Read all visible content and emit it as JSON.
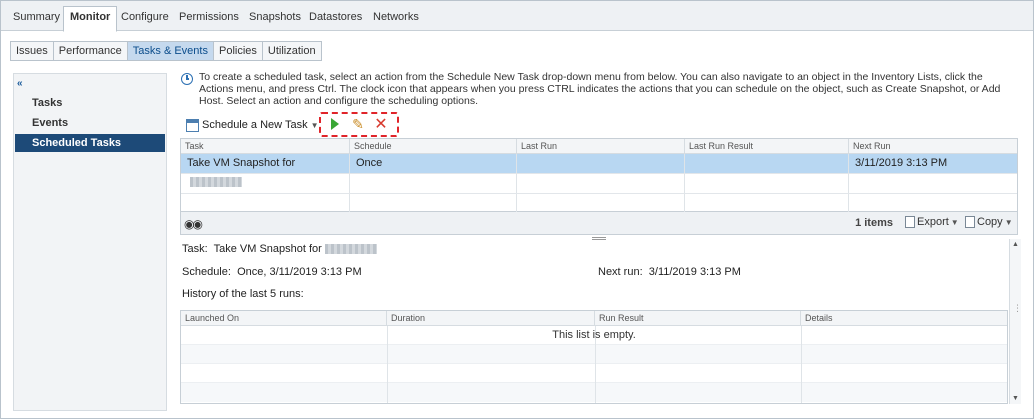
{
  "top_tabs": [
    {
      "label": "Summary"
    },
    {
      "label": "Monitor"
    },
    {
      "label": "Configure"
    },
    {
      "label": "Permissions"
    },
    {
      "label": "Snapshots"
    },
    {
      "label": "Datastores"
    },
    {
      "label": "Networks"
    }
  ],
  "sub_tabs": [
    {
      "label": "Issues"
    },
    {
      "label": "Performance"
    },
    {
      "label": "Tasks & Events"
    },
    {
      "label": "Policies"
    },
    {
      "label": "Utilization"
    }
  ],
  "left_nav": {
    "collapse_glyph": "«",
    "items": [
      {
        "label": "Tasks"
      },
      {
        "label": "Events"
      },
      {
        "label": "Scheduled Tasks"
      }
    ]
  },
  "info": {
    "text": "To create a scheduled task, select an action from the Schedule New Task drop-down menu from below. You can also navigate to an object in the Inventory Lists, click the Actions menu, and press Ctrl. The clock icon that appears when you press CTRL indicates the actions that you can schedule on the object, such as Create Snapshot, or Add Host. Select an action and configure the scheduling options."
  },
  "toolbar": {
    "schedule_new_task": "Schedule a New Task",
    "run_icon": "play-icon",
    "edit_icon": "pencil-icon",
    "delete_icon": "x-icon"
  },
  "tasks_table": {
    "columns": [
      "Task",
      "Schedule",
      "Last Run",
      "Last Run Result",
      "Next Run"
    ],
    "rows": [
      {
        "task": "Take VM Snapshot for",
        "schedule": "Once",
        "last_run": "",
        "last_run_result": "",
        "next_run": "3/11/2019 3:13 PM"
      }
    ]
  },
  "footer": {
    "items_count": "1 items",
    "export_label": "Export",
    "copy_label": "Copy"
  },
  "details": {
    "task_label": "Task:",
    "task_value": "Take VM Snapshot for",
    "schedule_label": "Schedule:",
    "schedule_value": "Once, 3/11/2019 3:13 PM",
    "next_run_label": "Next run:",
    "next_run_value": "3/11/2019 3:13 PM",
    "history_label": "History of the last 5 runs:"
  },
  "history_table": {
    "columns": [
      "Launched On",
      "Duration",
      "Run Result",
      "Details"
    ],
    "empty_message": "This list is empty."
  },
  "colors": {
    "accent": "#1d4a78",
    "selection": "#b8d7f2",
    "highlight_box": "#e0242a",
    "run": "#3aa635",
    "edit": "#c98b25",
    "delete": "#d83a2e"
  }
}
